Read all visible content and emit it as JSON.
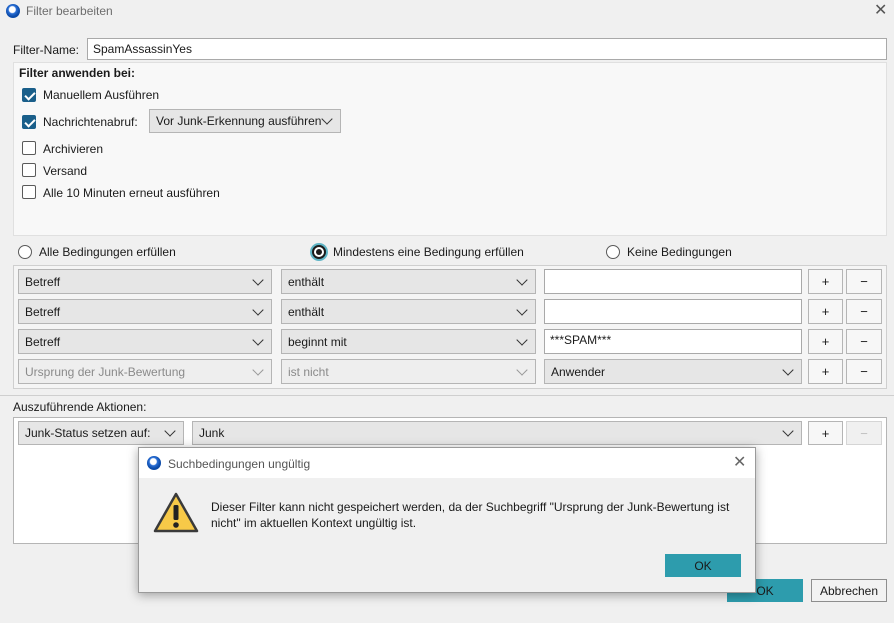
{
  "window": {
    "title": "Filter bearbeiten"
  },
  "filter_name": {
    "label": "Filter-Name:",
    "value": "SpamAssassinYes"
  },
  "apply": {
    "heading": "Filter anwenden bei:",
    "manual": {
      "label": "Manuellem Ausführen",
      "checked": true
    },
    "fetch": {
      "label": "Nachrichtenabruf:",
      "checked": true,
      "option": "Vor Junk-Erkennung ausführen"
    },
    "archive": {
      "label": "Archivieren",
      "checked": false
    },
    "send": {
      "label": "Versand",
      "checked": false
    },
    "periodic": {
      "label": "Alle 10 Minuten erneut ausführen",
      "checked": false
    }
  },
  "match": {
    "all": "Alle Bedingungen erfüllen",
    "any": "Mindestens eine Bedingung erfüllen",
    "none": "Keine Bedingungen",
    "selected": "any"
  },
  "conditions": [
    {
      "attribute": "Betreff",
      "operator": "enthält",
      "value": ""
    },
    {
      "attribute": "Betreff",
      "operator": "enthält",
      "value": ""
    },
    {
      "attribute": "Betreff",
      "operator": "beginnt mit",
      "value": "***SPAM***"
    },
    {
      "attribute": "Ursprung der Junk-Bewertung",
      "operator": "ist nicht",
      "value": "Anwender"
    }
  ],
  "buttons": {
    "plus": "+",
    "minus": "−",
    "ok": "OK",
    "cancel": "Abbrechen"
  },
  "actions": {
    "heading": "Auszuführende Aktionen:",
    "items": [
      {
        "action": "Junk-Status setzen auf:",
        "value": "Junk"
      }
    ]
  },
  "alert": {
    "title": "Suchbedingungen ungültig",
    "message_line1": "Dieser Filter kann nicht gespeichert werden, da der Suchbegriff \"Ursprung der Junk-Bewertung ist",
    "message_line2": "nicht\" im aktuellen Kontext ungültig ist.",
    "ok": "OK"
  }
}
